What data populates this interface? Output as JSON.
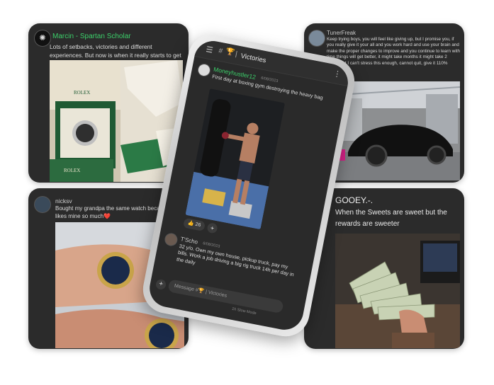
{
  "cards": {
    "marcin": {
      "username": "Marcin - Spartan Scholar",
      "text": "Lots of setbacks, victories and different experiences. But now is when it really starts to get serious.",
      "image_alt": "Rolex watch in green box",
      "watch_brand": "ROLEX",
      "box_brand": "ROLEX"
    },
    "tunerfreak": {
      "username": "TunerFreak",
      "text": "Keep trying boys, you will feel like giving up, but I promise you, if you really give it your all and you work hard and use your brain and make the proper changes to improve and you continue to learn with time things will get better, it might take months it might take 2 years, but I can't stress this enough, cannot quit, give it 110%"
    },
    "nicksv": {
      "username": "nicksv",
      "text": "Bought my grandpa the same watch because he likes mine so much❤️"
    },
    "gooey": {
      "username": "GOOEY.-.",
      "text": "When the Sweets are sweet but the rewards are sweeter"
    }
  },
  "phone": {
    "channel_title": "Victories",
    "post1": {
      "username": "Moneyhustler12",
      "date": "6/08/2023",
      "text": "First day at boxing gym destroying the heavy bag",
      "reaction_emoji": "👍",
      "reaction_count": "26",
      "add_reaction": "+"
    },
    "post2": {
      "username": "T'Scho",
      "date": "6/08/2023",
      "text": "32 y/o. Own my own house, pickup truck, pay my bills. Work a job driving a big rig truck 14h per day in the daily"
    },
    "composer": {
      "placeholder": "Message #🏆 | Victories",
      "slow_mode": "1h Slow Mode",
      "plus": "+"
    }
  },
  "colors": {
    "card_bg": "#2b2b2b",
    "green_username": "#3ccf6a",
    "text": "#dcdcdc"
  }
}
